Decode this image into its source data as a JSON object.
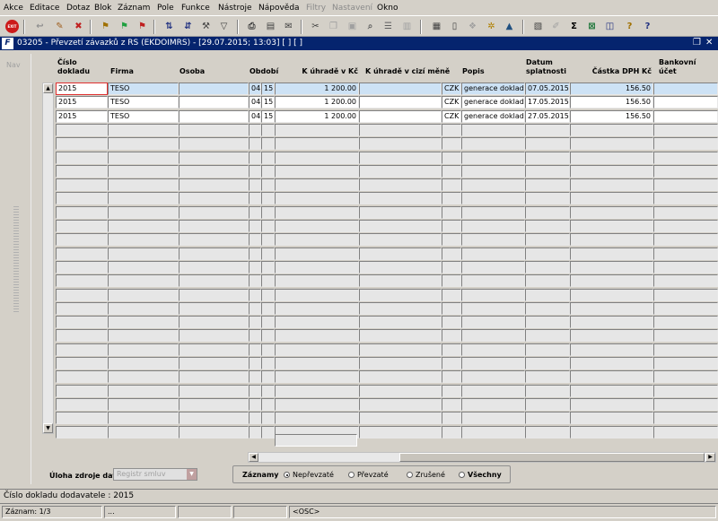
{
  "menu": [
    "Akce",
    "Editace",
    "Dotaz",
    "Blok",
    "Záznam",
    "Pole",
    "Funkce",
    "Nástroje",
    "Nápověda",
    "Filtry",
    "Nastavení",
    "Okno"
  ],
  "menu_disabled": [
    "Filtry",
    "Nastavení"
  ],
  "toolbar": {
    "exit_label": "EXIT"
  },
  "window": {
    "title": "03205 - Převzetí závazků z RS (EKDOIMRS) - [29.07.2015; 13:03]  [ ]  [ ]"
  },
  "nav": {
    "label": "Nav"
  },
  "columns": {
    "cislo": "Číslo dokladu",
    "firma": "Firma",
    "osoba": "Osoba",
    "obdobi": "Období",
    "k_uhrade_kc": "K úhradě v Kč",
    "k_uhrade_cizi": "K úhradě v cizí měně",
    "popis": "Popis",
    "datum": "Datum splatnosti",
    "castka_dph": "Částka DPH Kč",
    "bankovni": "Bankovní účet"
  },
  "rows": [
    {
      "cislo": "2015",
      "firma": "TESO",
      "osoba": "",
      "obd1": "04",
      "obd2": "15",
      "kc": "1 200.00",
      "cizi": "",
      "mena": "CZK",
      "popis": "generace dokladu",
      "datum": "07.05.2015",
      "dph": "156.50",
      "banka": ""
    },
    {
      "cislo": "2015",
      "firma": "TESO",
      "osoba": "",
      "obd1": "04",
      "obd2": "15",
      "kc": "1 200.00",
      "cizi": "",
      "mena": "CZK",
      "popis": "generace dokladu",
      "datum": "17.05.2015",
      "dph": "156.50",
      "banka": ""
    },
    {
      "cislo": "2015",
      "firma": "TESO",
      "osoba": "",
      "obd1": "04",
      "obd2": "15",
      "kc": "1 200.00",
      "cizi": "",
      "mena": "CZK",
      "popis": "generace dokladu",
      "datum": "27.05.2015",
      "dph": "156.50",
      "banka": ""
    }
  ],
  "empty_row_count": 23,
  "uloha": {
    "label": "Úloha zdroje dat",
    "value": "Registr smluv"
  },
  "zaznamy": {
    "label": "Záznamy",
    "options": [
      {
        "label": "Nepřevzaté",
        "selected": true
      },
      {
        "label": "Převzaté",
        "selected": false
      },
      {
        "label": "Zrušené",
        "selected": false
      },
      {
        "label": "Všechny",
        "selected": false
      }
    ]
  },
  "message": "Číslo dokladu dodavatele : 2015",
  "status": {
    "record": "Záznam: 1/3",
    "s2": "...",
    "s3": "",
    "s4": "",
    "osc": "<OSC>"
  },
  "colors": {
    "title_bar": "#05246e",
    "selected_row": "#cde2f5",
    "focus_border": "#e03030"
  }
}
